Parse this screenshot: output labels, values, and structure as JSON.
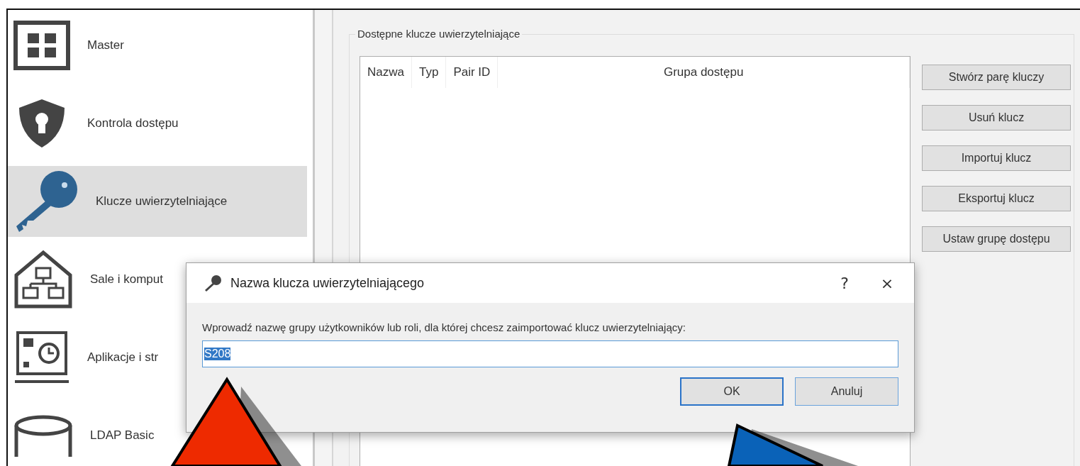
{
  "sidebar": {
    "items": [
      {
        "kind": "grid",
        "label": "Master",
        "selected": false
      },
      {
        "kind": "shield",
        "label": "Kontrola dostępu",
        "selected": false
      },
      {
        "kind": "key",
        "label": "Klucze uwierzytelniające",
        "selected": true
      },
      {
        "kind": "rooms",
        "label": "Sale i komput",
        "selected": false
      },
      {
        "kind": "apps",
        "label": "Aplikacje i str",
        "selected": false
      },
      {
        "kind": "database",
        "label": "LDAP Basic",
        "selected": false
      }
    ]
  },
  "group": {
    "title": "Dostępne klucze uwierzytelniające",
    "table": {
      "columns": [
        "Nazwa",
        "Typ",
        "Pair ID",
        "Grupa dostępu"
      ]
    },
    "buttons": [
      "Stwórz parę kluczy",
      "Usuń klucz",
      "Importuj klucz",
      "Eksportuj klucz",
      "Ustaw grupę dostępu"
    ]
  },
  "dialog": {
    "title": "Nazwa klucza uwierzytelniającego",
    "help": "?",
    "close": "×",
    "prompt": "Wprowadź nazwę grupy użytkowników lub roli, dla której chcesz zaimportować klucz uwierzytelniający:",
    "value": "S208",
    "value_selected": true,
    "buttons": [
      {
        "label": "OK",
        "default": true
      },
      {
        "label": "Anuluj",
        "default": false
      }
    ]
  },
  "annotations": [
    {
      "kind": "up",
      "color": "#ee2a00"
    },
    {
      "kind": "slant",
      "color": "#0a62b8"
    }
  ]
}
